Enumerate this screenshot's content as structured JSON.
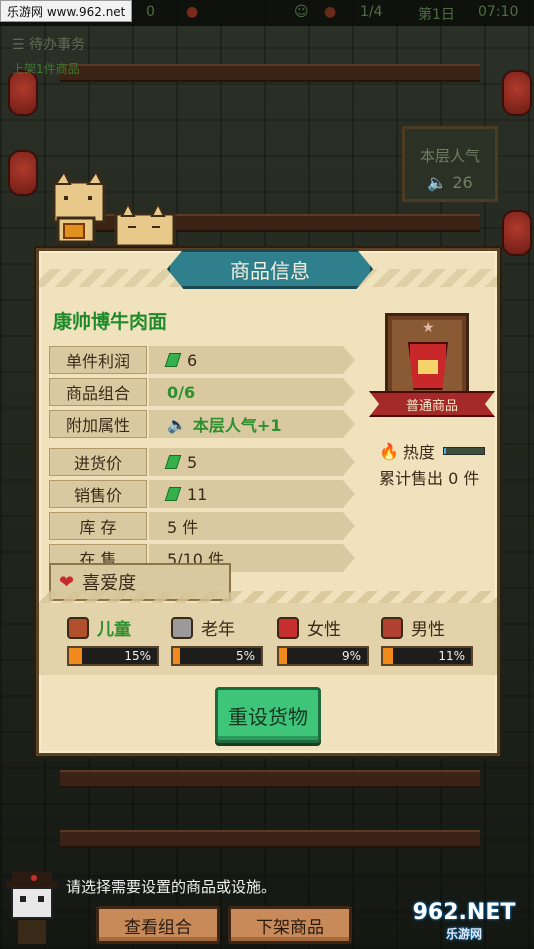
{
  "watermark_top": "乐游网 www.962.net",
  "status": {
    "money": "0",
    "floor": "1/4",
    "day": "第1日",
    "time": "07:10"
  },
  "todo": {
    "title": "待办事务",
    "task": "上架1件商品"
  },
  "popularity_sign": {
    "label": "本层人气",
    "value": "26"
  },
  "panel": {
    "title": "商品信息",
    "item_name": "康帅博牛肉面",
    "rows": [
      {
        "label": "单件利润",
        "value": "6",
        "icon": "cash-icon"
      },
      {
        "label": "商品组合",
        "value": "0/6"
      },
      {
        "label": "附加属性",
        "value": "本层人气+1",
        "icon": "speaker-icon"
      },
      {
        "label": "进货价",
        "value": "5",
        "icon": "cash-icon"
      },
      {
        "label": "销售价",
        "value": "11",
        "icon": "cash-icon"
      },
      {
        "label": "库 存",
        "value": "5 件"
      },
      {
        "label": "在 售",
        "value": "5/10 件"
      }
    ],
    "preference_label": "喜爱度",
    "grade": "普通商品",
    "heat_label": "热度",
    "heat_level": 0.05,
    "sold_label": "累计售出 0 件",
    "demographics": [
      {
        "name": "儿童",
        "pct": "15%",
        "level": 0.15,
        "highlight": true,
        "color": "#b0502c"
      },
      {
        "name": "老年",
        "pct": "5%",
        "level": 0.05,
        "highlight": false,
        "color": "#9a9a9a"
      },
      {
        "name": "女性",
        "pct": "9%",
        "level": 0.09,
        "highlight": false,
        "color": "#c83030"
      },
      {
        "name": "男性",
        "pct": "11%",
        "level": 0.11,
        "highlight": false,
        "color": "#b04030"
      }
    ],
    "reset_button": "重设货物"
  },
  "hint": "请选择需要设置的商品或设施。",
  "buttons": {
    "view_combo": "查看组合",
    "remove": "下架商品"
  },
  "watermark_bottom": {
    "big": "962.NET",
    "small": "乐游网"
  }
}
